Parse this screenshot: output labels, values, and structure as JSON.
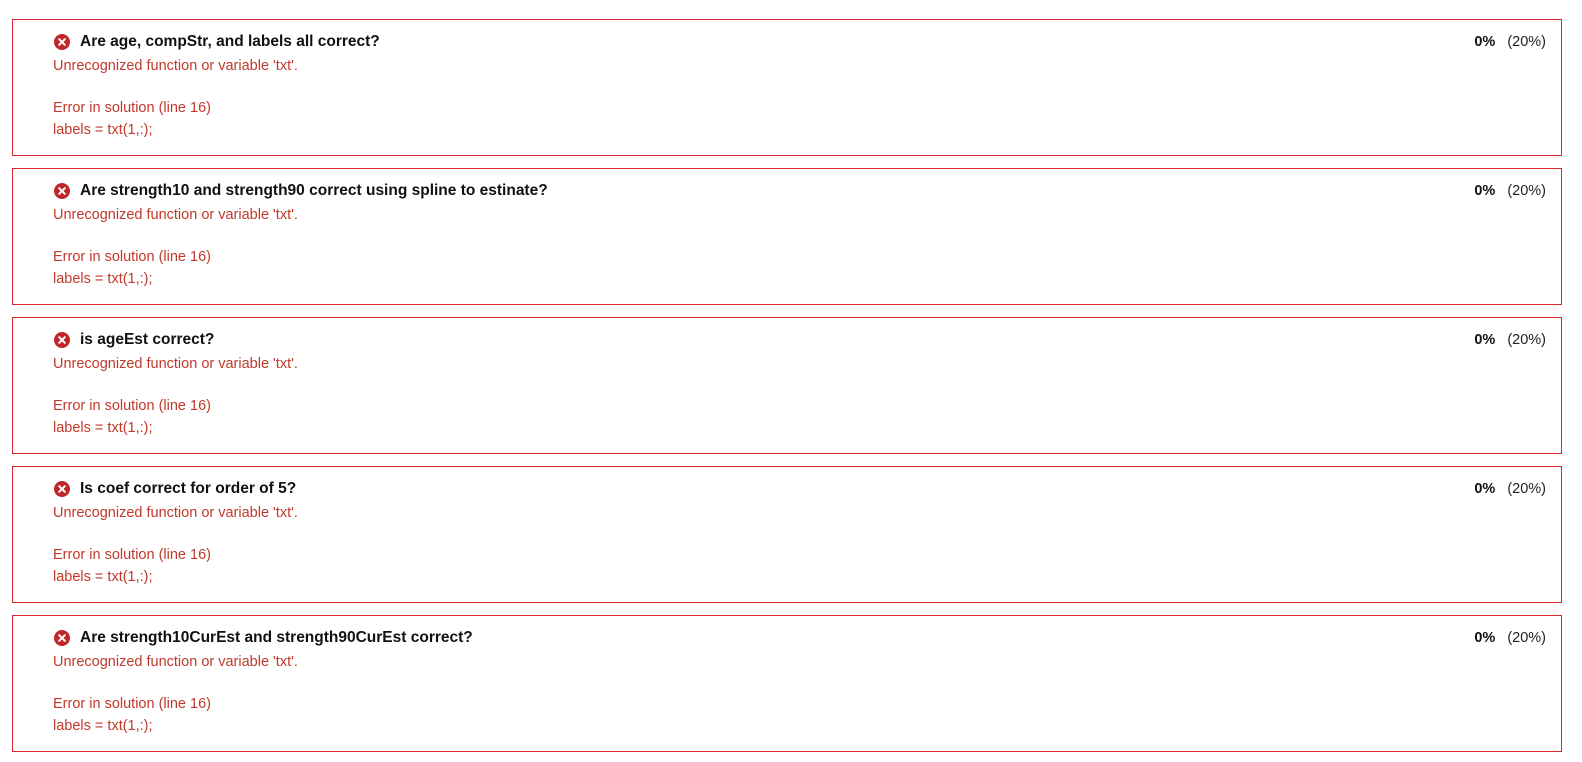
{
  "colors": {
    "fail_border": "#d9272e",
    "fail_icon": "#c0272d",
    "error_text": "#c0392b",
    "title_text": "#111111"
  },
  "tests": [
    {
      "status": "fail",
      "icon": "x-circle-icon",
      "title": "Are age, compStr, and labels all correct?",
      "score": "0%",
      "weight": "(20%)",
      "error_message": "Unrecognized function or variable 'txt'.",
      "error_location": "Error in solution (line 16)",
      "error_code": "labels = txt(1,:);"
    },
    {
      "status": "fail",
      "icon": "x-circle-icon",
      "title": "Are strength10 and strength90 correct using spline to estinate?",
      "score": "0%",
      "weight": "(20%)",
      "error_message": "Unrecognized function or variable 'txt'.",
      "error_location": "Error in solution (line 16)",
      "error_code": "labels = txt(1,:);"
    },
    {
      "status": "fail",
      "icon": "x-circle-icon",
      "title": "is ageEst correct?",
      "score": "0%",
      "weight": "(20%)",
      "error_message": "Unrecognized function or variable 'txt'.",
      "error_location": "Error in solution (line 16)",
      "error_code": "labels = txt(1,:);"
    },
    {
      "status": "fail",
      "icon": "x-circle-icon",
      "title": "Is coef correct for order of 5?",
      "score": "0%",
      "weight": "(20%)",
      "error_message": "Unrecognized function or variable 'txt'.",
      "error_location": "Error in solution (line 16)",
      "error_code": "labels = txt(1,:);"
    },
    {
      "status": "fail",
      "icon": "x-circle-icon",
      "title": "Are strength10CurEst and strength90CurEst correct?",
      "score": "0%",
      "weight": "(20%)",
      "error_message": "Unrecognized function or variable 'txt'.",
      "error_location": "Error in solution (line 16)",
      "error_code": "labels = txt(1,:);"
    }
  ]
}
